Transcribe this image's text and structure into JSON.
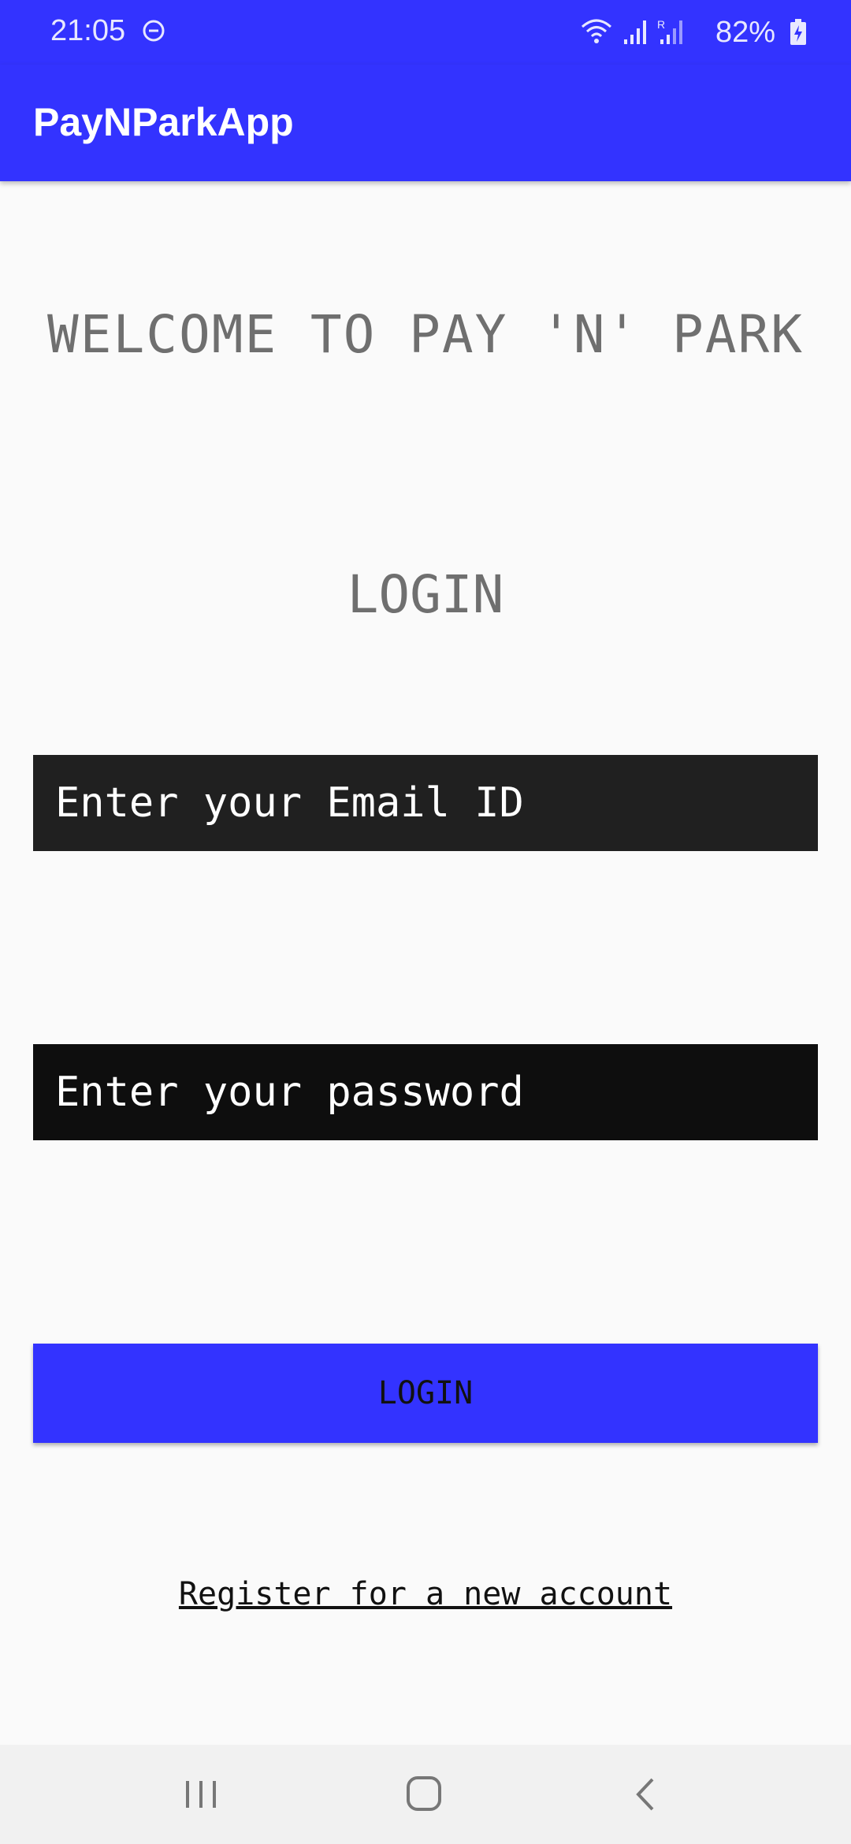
{
  "status_bar": {
    "time": "21:05",
    "battery": "82%",
    "icons": [
      "do-not-disturb-icon",
      "wifi-icon",
      "signal-icon",
      "signal-roaming-icon",
      "battery-charging-icon"
    ]
  },
  "app_bar": {
    "title": "PayNParkApp"
  },
  "main": {
    "welcome": "WELCOME TO PAY 'N' PARK",
    "login_heading": "LOGIN",
    "email_placeholder": "Enter your Email ID",
    "password_placeholder": "Enter your password",
    "login_button": "LOGIN",
    "register_link": "Register for a new account"
  },
  "nav_bar": {
    "icons": [
      "recent-apps-icon",
      "home-icon",
      "back-icon"
    ]
  },
  "colors": {
    "primary": "#3333ff",
    "background": "#fafafa",
    "field_background": "#1a1a1a",
    "heading_text": "#6f6f6f"
  }
}
